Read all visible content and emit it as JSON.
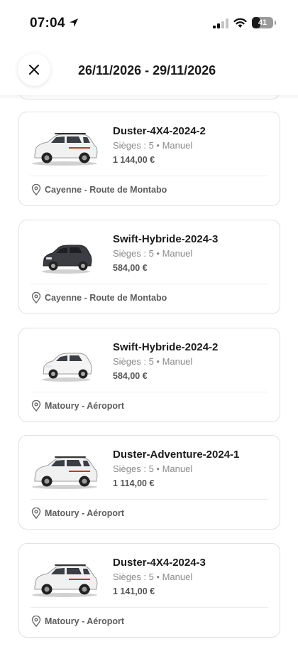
{
  "status_bar": {
    "time": "07:04",
    "battery": "41",
    "battery_level": 0.41
  },
  "header": {
    "date_range": "26/11/2026 - 29/11/2026"
  },
  "cars": [
    {
      "name": "Duster-4X4-2024-2",
      "specs": "Sièges : 5 • Manuel",
      "price": "1 144,00 €",
      "location": "Cayenne - Route de Montabo",
      "body_color": "#f1f1f1",
      "model": "suv"
    },
    {
      "name": "Swift-Hybride-2024-3",
      "specs": "Sièges : 5 • Manuel",
      "price": "584,00 €",
      "location": "Cayenne - Route de Montabo",
      "body_color": "#3c3d42",
      "model": "hatch"
    },
    {
      "name": "Swift-Hybride-2024-2",
      "specs": "Sièges : 5 • Manuel",
      "price": "584,00 €",
      "location": "Matoury - Aéroport",
      "body_color": "#f4f4f4",
      "model": "hatch"
    },
    {
      "name": "Duster-Adventure-2024-1",
      "specs": "Sièges : 5 • Manuel",
      "price": "1 114,00 €",
      "location": "Matoury - Aéroport",
      "body_color": "#f1f1f1",
      "model": "suv"
    },
    {
      "name": "Duster-4X4-2024-3",
      "specs": "Sièges : 5 • Manuel",
      "price": "1 141,00 €",
      "location": "Matoury - Aéroport",
      "body_color": "#f1f1f1",
      "model": "suv"
    }
  ],
  "icons": {
    "close": "close-icon",
    "location": "location-pin-icon"
  }
}
